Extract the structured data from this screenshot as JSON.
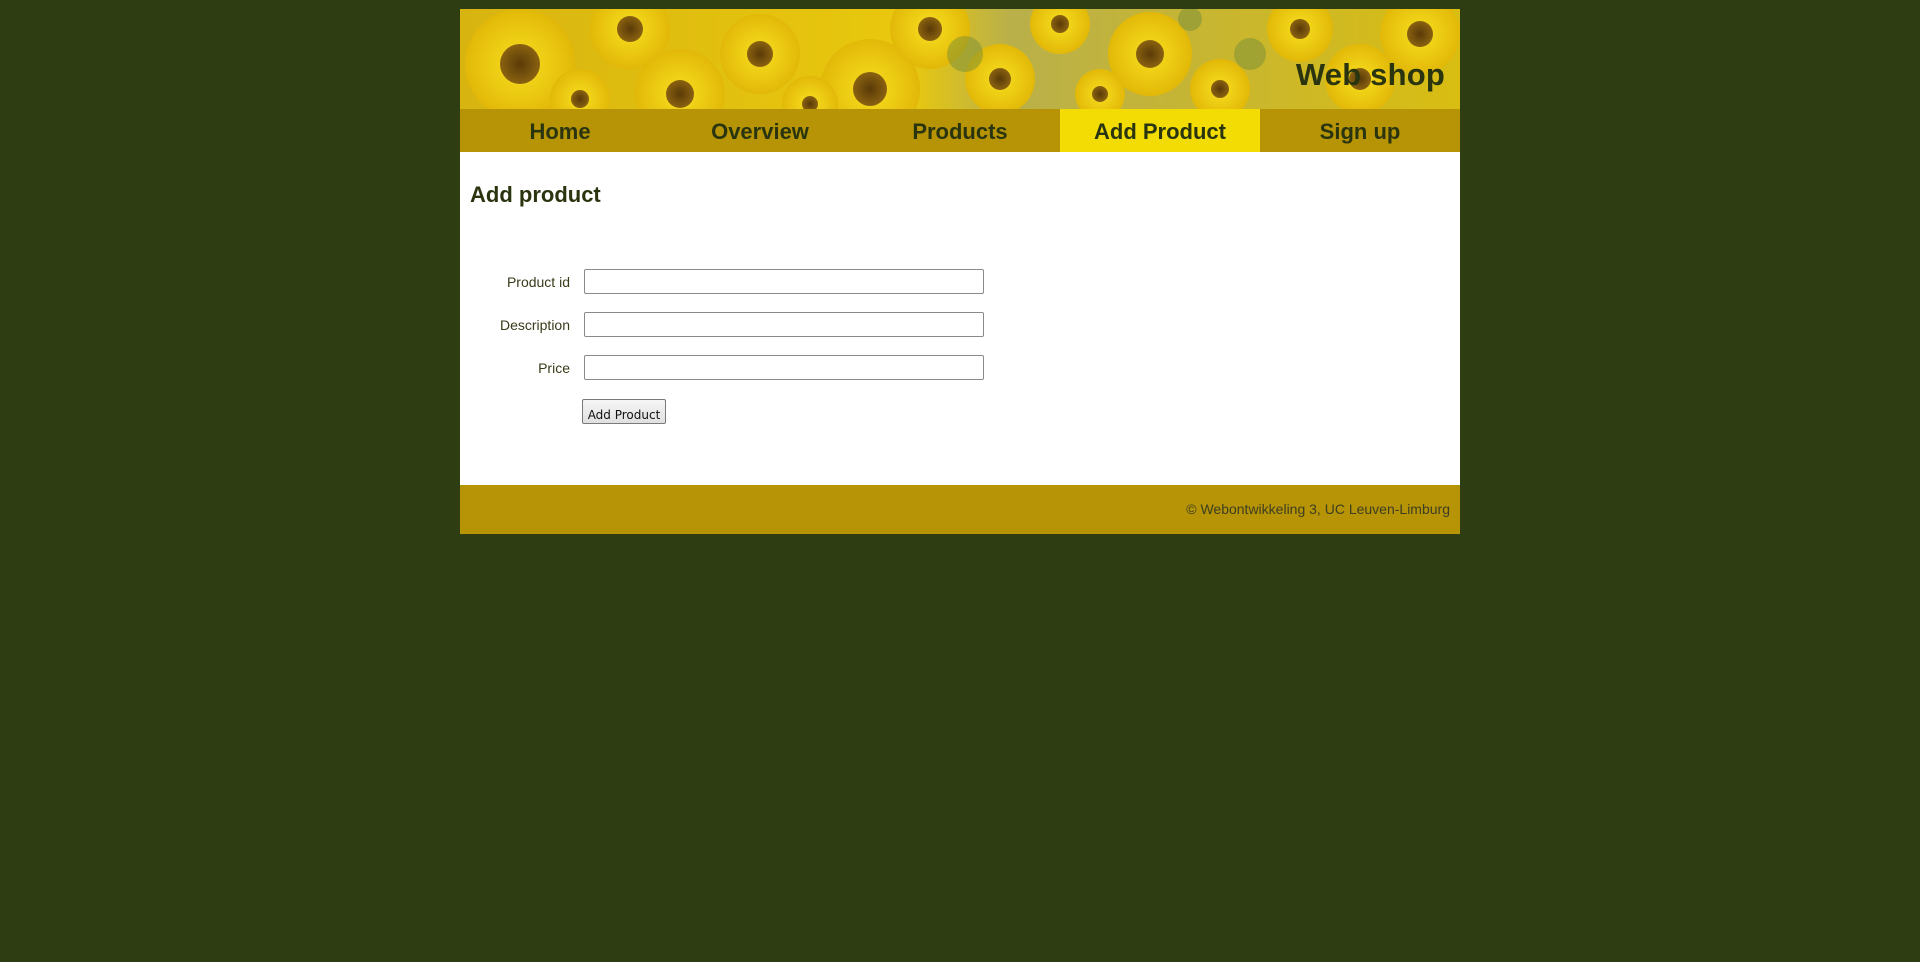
{
  "header": {
    "site_title": "Web shop"
  },
  "nav": {
    "items": [
      {
        "label": "Home"
      },
      {
        "label": "Overview"
      },
      {
        "label": "Products"
      },
      {
        "label": "Add Product",
        "active": true
      },
      {
        "label": "Sign up"
      }
    ]
  },
  "main": {
    "heading": "Add product",
    "form": {
      "product_id_label": "Product id",
      "product_id_value": "",
      "description_label": "Description",
      "description_value": "",
      "price_label": "Price",
      "price_value": "",
      "submit_label": "Add Product"
    }
  },
  "footer": {
    "text": "© Webontwikkeling 3, UC Leuven-Limburg"
  },
  "colors": {
    "background": "#2f3d12",
    "nav": "#b69405",
    "nav_active": "#f2dc04",
    "text_dark": "#2a3510"
  }
}
